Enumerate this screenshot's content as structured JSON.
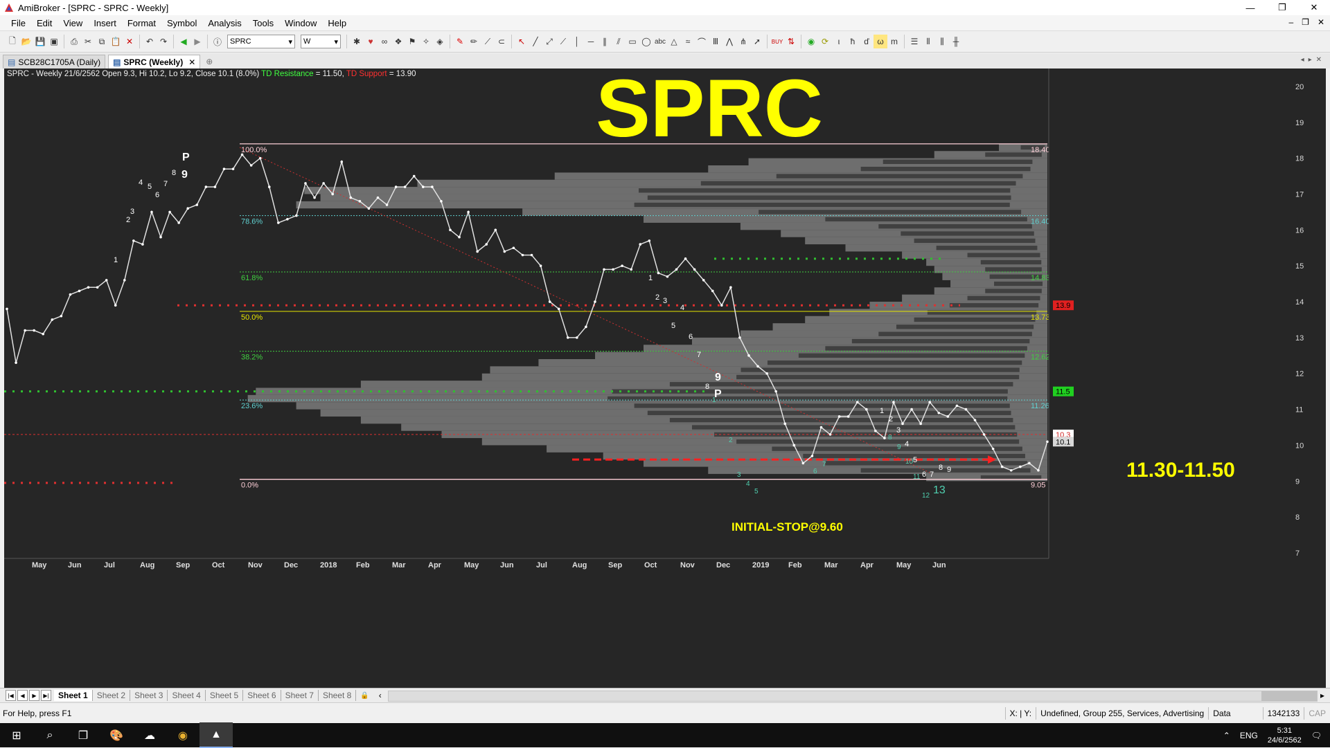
{
  "window": {
    "title": "AmiBroker - [SPRC - SPRC - Weekly]",
    "controls": [
      "—",
      "❐",
      "✕"
    ]
  },
  "menu": {
    "items": [
      "File",
      "Edit",
      "View",
      "Insert",
      "Format",
      "Symbol",
      "Analysis",
      "Tools",
      "Window",
      "Help"
    ],
    "mdi_controls": [
      "‒",
      "❐",
      "✕"
    ]
  },
  "toolbar": {
    "symbol_value": "SPRC",
    "interval_value": "W"
  },
  "tabs": [
    {
      "label": "SCB28C1705A (Daily)",
      "active": false
    },
    {
      "label": "SPRC (Weekly)",
      "active": true,
      "close": "✕"
    }
  ],
  "chart": {
    "header_main": "SPRC - Weekly 21/6/2562 Open 9.3, Hi 10.2, Lo 9.2, Close 10.1 (8.0%)",
    "header_res_label": "TD Resistance",
    "header_res_value": " = 11.50,",
    "header_sup_label": "TD Support",
    "header_sup_value": " = 13.90",
    "big_title": "SPRC",
    "target_text": "11.30-11.50",
    "stop_text": "INITIAL-STOP@9.60",
    "fib_left_labels": [
      "100.0%",
      "78.6%",
      "61.8%",
      "50.0%",
      "38.2%",
      "23.6%",
      "0.0%"
    ],
    "fib_right_labels": [
      "18.40",
      "16.40",
      "14.83",
      "13.73",
      "12.62",
      "11.26",
      "9.05"
    ],
    "fib_colors": [
      "#ffd0d8",
      "#60d0d0",
      "#40d040",
      "#e6e600",
      "#40d040",
      "#60d0d0",
      "#ffd0d8"
    ],
    "badges": [
      "13.9",
      "11.5",
      "10.3",
      "10.1"
    ],
    "td_counts": {
      "white": [
        "1",
        "2",
        "3",
        "4",
        "5",
        "6",
        "7",
        "8",
        "9",
        "P",
        "1",
        "2",
        "3",
        "4",
        "5",
        "6",
        "7",
        "8",
        "9",
        "P",
        "1",
        "2",
        "3",
        "4",
        "5",
        "6",
        "7",
        "8",
        "9"
      ],
      "cyan": [
        "1",
        "2",
        "3",
        "4",
        "5",
        "6",
        "7",
        "8",
        "9",
        "10",
        "11",
        "12",
        "13"
      ]
    }
  },
  "chart_data": {
    "type": "line",
    "title": "SPRC",
    "xlabel": "",
    "ylabel": "",
    "ylim": [
      7,
      20.5
    ],
    "y_ticks": [
      20,
      19,
      18,
      17,
      16,
      15,
      14,
      13,
      12,
      11,
      10,
      9,
      8,
      7
    ],
    "x_ticks": [
      "May",
      "Jun",
      "Jul",
      "Aug",
      "Sep",
      "Oct",
      "Nov",
      "Dec",
      "2018",
      "Feb",
      "Mar",
      "Apr",
      "May",
      "Jun",
      "Jul",
      "Aug",
      "Sep",
      "Oct",
      "Nov",
      "Dec",
      "2019",
      "Feb",
      "Mar",
      "Apr",
      "May",
      "Jun"
    ],
    "close_weekly": [
      13.8,
      12.3,
      13.2,
      13.2,
      13.1,
      13.5,
      13.6,
      14.2,
      14.3,
      14.4,
      14.4,
      14.6,
      13.9,
      14.6,
      15.7,
      15.6,
      16.5,
      15.8,
      16.5,
      16.2,
      16.6,
      16.7,
      17.2,
      17.2,
      17.7,
      17.7,
      18.1,
      17.8,
      18.0,
      17.2,
      16.2,
      16.3,
      16.4,
      17.3,
      16.9,
      17.3,
      17.0,
      17.9,
      16.9,
      16.8,
      16.6,
      16.9,
      16.7,
      17.2,
      17.2,
      17.5,
      17.2,
      17.2,
      16.8,
      16.0,
      15.8,
      16.5,
      15.4,
      15.6,
      16.0,
      15.4,
      15.5,
      15.3,
      15.3,
      15.0,
      14.0,
      13.8,
      13.0,
      13.0,
      13.3,
      14.0,
      14.9,
      14.9,
      15.0,
      14.9,
      15.6,
      15.7,
      14.8,
      14.7,
      14.9,
      15.2,
      14.9,
      14.6,
      14.3,
      13.9,
      14.4,
      13.0,
      12.5,
      12.2,
      12.0,
      11.5,
      10.6,
      10.0,
      9.5,
      9.7,
      10.5,
      10.3,
      10.8,
      10.8,
      11.2,
      11.0,
      10.4,
      10.2,
      11.2,
      10.6,
      11.0,
      10.6,
      11.2,
      10.9,
      10.8,
      11.1,
      11.0,
      10.7,
      10.3,
      9.9,
      9.4,
      9.3,
      9.4,
      9.5,
      9.3,
      10.1
    ],
    "fibonacci": {
      "high": 18.4,
      "low": 9.05,
      "levels": [
        {
          "ratio": "100.0%",
          "price": 18.4
        },
        {
          "ratio": "78.6%",
          "price": 16.4
        },
        {
          "ratio": "61.8%",
          "price": 14.83
        },
        {
          "ratio": "50.0%",
          "price": 13.73
        },
        {
          "ratio": "38.2%",
          "price": 12.62
        },
        {
          "ratio": "23.6%",
          "price": 11.26
        },
        {
          "ratio": "0.0%",
          "price": 9.05
        }
      ]
    },
    "td_resistance": 11.5,
    "td_support": 13.9,
    "initial_stop": 9.6,
    "last_close": 10.1,
    "marker_10_3": 10.3,
    "volume_profile": [
      {
        "price": 18.3,
        "value": 0.06
      },
      {
        "price": 18.1,
        "value": 0.14
      },
      {
        "price": 17.9,
        "value": 0.37
      },
      {
        "price": 17.7,
        "value": 0.42
      },
      {
        "price": 17.5,
        "value": 0.61
      },
      {
        "price": 17.3,
        "value": 0.78
      },
      {
        "price": 17.1,
        "value": 0.92
      },
      {
        "price": 16.9,
        "value": 0.9
      },
      {
        "price": 16.7,
        "value": 0.93
      },
      {
        "price": 16.5,
        "value": 0.65
      },
      {
        "price": 16.3,
        "value": 0.5
      },
      {
        "price": 16.1,
        "value": 0.38
      },
      {
        "price": 15.9,
        "value": 0.33
      },
      {
        "price": 15.7,
        "value": 0.3
      },
      {
        "price": 15.5,
        "value": 0.25
      },
      {
        "price": 15.3,
        "value": 0.18
      },
      {
        "price": 15.1,
        "value": 0.15
      },
      {
        "price": 14.9,
        "value": 0.14
      },
      {
        "price": 14.7,
        "value": 0.13
      },
      {
        "price": 14.5,
        "value": 0.12
      },
      {
        "price": 14.3,
        "value": 0.14
      },
      {
        "price": 14.1,
        "value": 0.18
      },
      {
        "price": 13.9,
        "value": 0.22
      },
      {
        "price": 13.7,
        "value": 0.27
      },
      {
        "price": 13.5,
        "value": 0.3
      },
      {
        "price": 13.3,
        "value": 0.34
      },
      {
        "price": 13.1,
        "value": 0.38
      },
      {
        "price": 12.9,
        "value": 0.44
      },
      {
        "price": 12.7,
        "value": 0.5
      },
      {
        "price": 12.5,
        "value": 0.56
      },
      {
        "price": 12.3,
        "value": 0.63
      },
      {
        "price": 12.1,
        "value": 0.69
      },
      {
        "price": 11.9,
        "value": 0.7
      },
      {
        "price": 11.7,
        "value": 0.85
      },
      {
        "price": 11.5,
        "value": 0.98
      },
      {
        "price": 11.3,
        "value": 0.99
      },
      {
        "price": 11.1,
        "value": 0.93
      },
      {
        "price": 10.9,
        "value": 0.9
      },
      {
        "price": 10.7,
        "value": 0.85
      },
      {
        "price": 10.5,
        "value": 0.8
      },
      {
        "price": 10.3,
        "value": 0.75
      },
      {
        "price": 10.1,
        "value": 0.7
      },
      {
        "price": 9.9,
        "value": 0.62
      },
      {
        "price": 9.7,
        "value": 0.55
      },
      {
        "price": 9.5,
        "value": 0.5
      },
      {
        "price": 9.3,
        "value": 0.42
      },
      {
        "price": 9.1,
        "value": 0.15
      }
    ]
  },
  "sheets": {
    "tabs": [
      "Sheet 1",
      "Sheet 2",
      "Sheet 3",
      "Sheet 4",
      "Sheet 5",
      "Sheet 6",
      "Sheet 7",
      "Sheet 8"
    ],
    "active": 0
  },
  "status": {
    "help": "For Help, press F1",
    "xy": "X: | Y:",
    "group": "Undefined, Group 255, Services, Advertising",
    "data": "Data",
    "mem": "1342133",
    "cap": "CAP"
  },
  "taskbar": {
    "lang": "ENG",
    "time": "5:31",
    "date": "24/6/2562"
  },
  "colors": {
    "chart_bg": "#262626",
    "price_line": "#e0e0e0",
    "title_yellow": "#ffff00",
    "stop_red": "#ff2020"
  }
}
